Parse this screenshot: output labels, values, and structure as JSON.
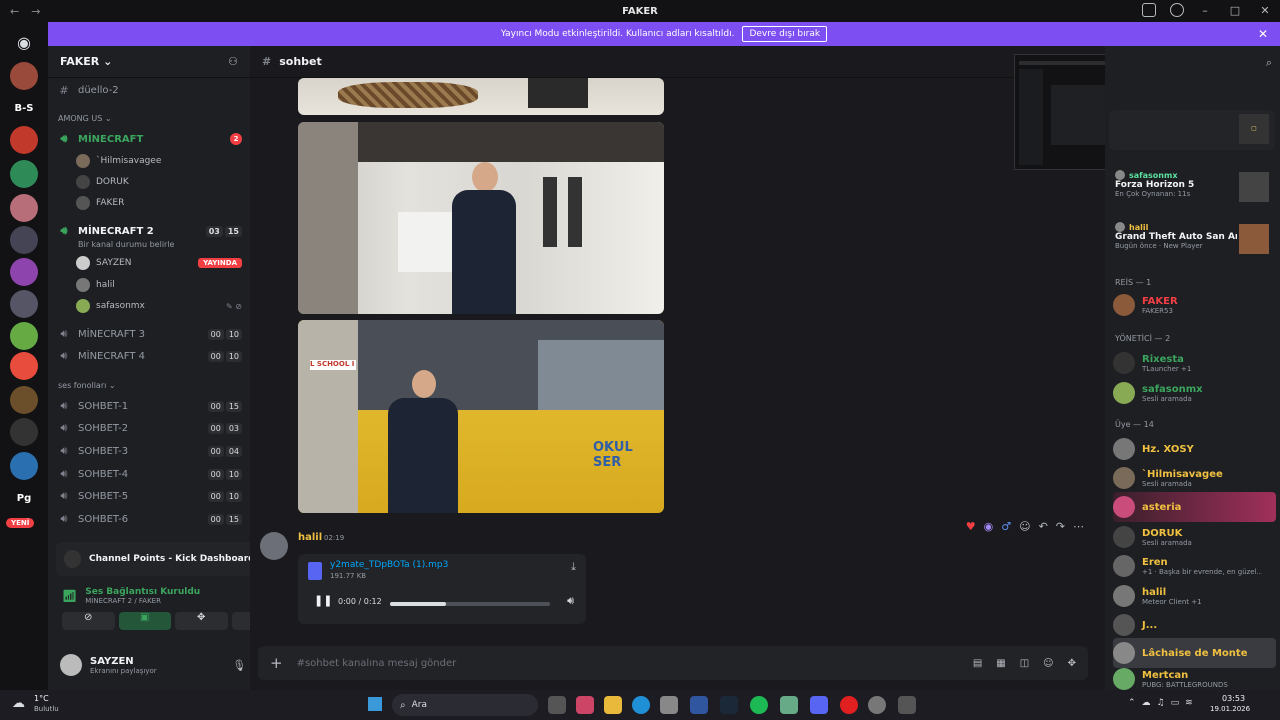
{
  "window": {
    "title": "FAKER"
  },
  "banner": {
    "text": "Yayıncı Modu etkinleştirildi. Kullanıcı adları kısaltıldı.",
    "button": "Devre dışı bırak"
  },
  "guilds": [
    "B-S",
    "Pg"
  ],
  "guild_new_label": "YENİ",
  "server": {
    "name": "FAKER"
  },
  "channels": [
    {
      "name": "düello-2",
      "type": "text"
    },
    {
      "category": "AMONG US"
    },
    {
      "name": "MİNECRAFT",
      "type": "voice",
      "count": "2"
    },
    {
      "name": "MİNECRAFT 2",
      "type": "voice",
      "status": "Bir kanal durumu belirle",
      "a": "03",
      "b": "15"
    },
    {
      "name": "MİNECRAFT 3",
      "a": "00",
      "b": "10"
    },
    {
      "name": "MİNECRAFT 4",
      "a": "00",
      "b": "10"
    },
    {
      "category": "ses fonolları"
    },
    {
      "name": "SOHBET-1",
      "a": "00",
      "b": "15"
    },
    {
      "name": "SOHBET-2",
      "a": "00",
      "b": "03"
    },
    {
      "name": "SOHBET-3",
      "a": "00",
      "b": "04"
    },
    {
      "name": "SOHBET-4",
      "a": "00",
      "b": "10"
    },
    {
      "name": "SOHBET-5",
      "a": "00",
      "b": "10"
    },
    {
      "name": "SOHBET-6",
      "a": "00",
      "b": "15"
    }
  ],
  "voice_users_mc1": [
    "`Hilmisavagee",
    "DORUK",
    "FAKER"
  ],
  "voice_users_mc2": [
    "SAYZEN",
    "halil",
    "safasonmx"
  ],
  "live_label": "YAYINDA",
  "notification": {
    "text": "Channel Points - Kick Dashboard - ..."
  },
  "voice_conn": {
    "title": "Ses Bağlantısı Kuruldu",
    "sub": "MİNECRAFT 2 / FAKER"
  },
  "me": {
    "name": "SAYZEN",
    "status": "Ekranını paylaşıyor"
  },
  "channel_header": {
    "name": "sohbet"
  },
  "message": {
    "author": "halil",
    "time": "02:19",
    "file": "y2mate_TDpBOTa (1).mp3",
    "size": "191.77 KB",
    "progress": "0:00 / 0:12",
    "progress_fraction": 0.35
  },
  "composer": {
    "placeholder": "#sohbet kanalına mesaj gönder"
  },
  "members": {
    "activity": [
      {
        "name": "safasonmx",
        "game": "Forza Horizon 5",
        "detail": "En Çok Oynanan: 11s"
      },
      {
        "name": "halil",
        "game": "Grand Theft Auto San Andr...",
        "detail": "Bugün önce · New Player"
      }
    ],
    "groups": [
      {
        "label": "REİS — 1",
        "items": [
          {
            "name": "FAKER",
            "status": "FAKER53",
            "color": "#f23f43"
          }
        ]
      },
      {
        "label": "YÖNETİCİ — 2",
        "items": [
          {
            "name": "Rixesta",
            "status": "TLauncher +1",
            "color": "#3ba55d"
          },
          {
            "name": "safasonmx",
            "status": "Sesli aramada",
            "color": "#3ba55d"
          }
        ]
      },
      {
        "label": "Üye — 14",
        "items": [
          {
            "name": "Hz. XOSY",
            "status": "",
            "color": "#f0c040"
          },
          {
            "name": "`Hilmisavagee",
            "status": "Sesli aramada",
            "color": "#f0c040"
          },
          {
            "name": "asteria",
            "status": "",
            "color": "#f0c040"
          },
          {
            "name": "DORUK",
            "status": "Sesli aramada",
            "color": "#f0c040"
          },
          {
            "name": "Eren",
            "status": "+1 · Başka bir evrende, en güzel...",
            "color": "#f0c040"
          },
          {
            "name": "halil",
            "status": "Meteor Client +1",
            "color": "#f0c040"
          },
          {
            "name": "J...",
            "status": "",
            "color": "#f0c040"
          },
          {
            "name": "Lâchaise de Monte",
            "status": "",
            "color": "#f0c040"
          },
          {
            "name": "Mertcan",
            "status": "PUBG: BATTLEGROUNDS",
            "color": "#f0c040"
          }
        ]
      }
    ]
  },
  "taskbar": {
    "weather": "1°C",
    "weather_sub": "Bulutlu",
    "search": "Ara",
    "time": "03:53",
    "date": "19.01.2026"
  }
}
